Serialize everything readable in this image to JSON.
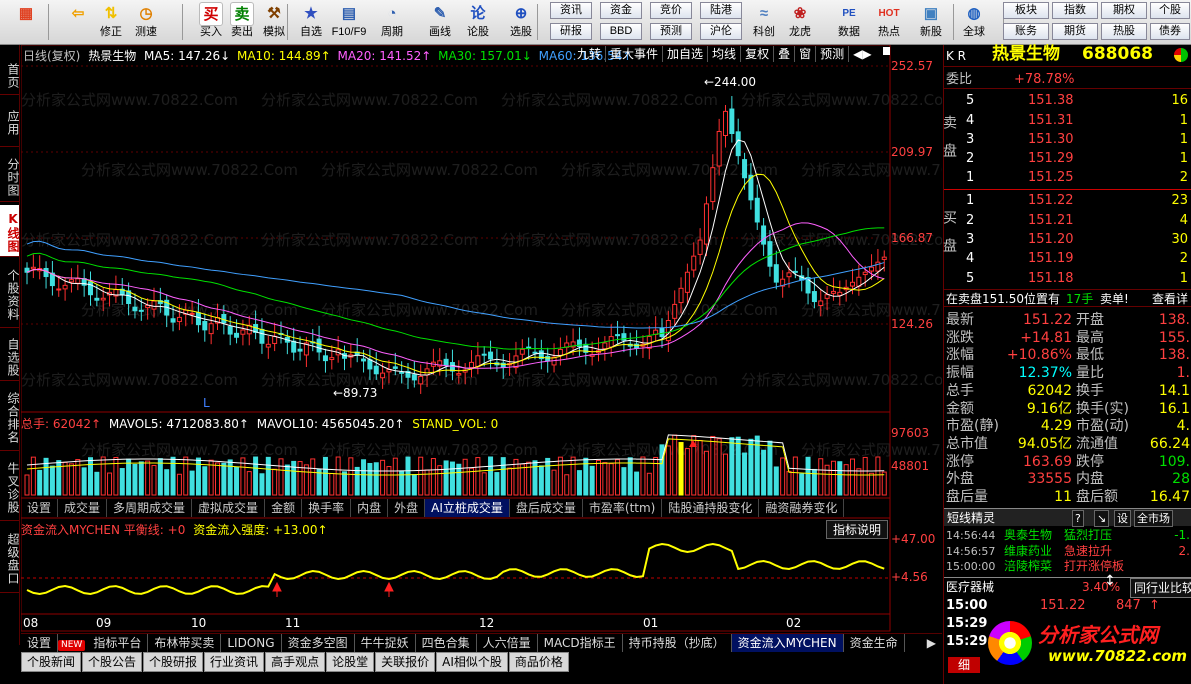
{
  "toolbar": {
    "buttons": [
      {
        "label": "",
        "icon": "grid-icon"
      },
      {
        "label": "",
        "icon": "back-arrow-icon"
      },
      {
        "label": "修正",
        "icon": "up-down-arrows-icon"
      },
      {
        "label": "测速",
        "icon": "clock-icon"
      },
      {
        "label": "买入",
        "icon": "buy-icon",
        "glyph": "买"
      },
      {
        "label": "卖出",
        "icon": "sell-icon",
        "glyph": "卖"
      },
      {
        "label": "模拟",
        "icon": "hammer-icon"
      },
      {
        "label": "自选",
        "icon": "star-icon"
      },
      {
        "label": "F10/F9",
        "icon": "f10-icon"
      },
      {
        "label": "周期",
        "icon": "cycle-icon"
      },
      {
        "label": "画线",
        "icon": "pencil-icon"
      },
      {
        "label": "论股",
        "icon": "discuss-icon",
        "glyph": "论"
      },
      {
        "label": "选股",
        "icon": "magnifier-icon"
      },
      {
        "label": "科创",
        "icon": "tech-chart-icon"
      },
      {
        "label": "龙虎",
        "icon": "dragon-icon"
      },
      {
        "label": "数据",
        "icon": "pe-icon",
        "glyph": "PE"
      },
      {
        "label": "热点",
        "icon": "hot-icon",
        "glyph": "HOT"
      },
      {
        "label": "新股",
        "icon": "new-stock-icon"
      },
      {
        "label": "全球",
        "icon": "globe-icon"
      }
    ],
    "grid1": [
      "资讯",
      "资金",
      "竞价",
      "陆港",
      "研报",
      "BBD",
      "预测",
      "沪伦"
    ],
    "grid2": [
      "板块",
      "指数",
      "期权",
      "个股",
      "账务",
      "期货",
      "热股",
      "债券"
    ]
  },
  "left_tabs": [
    "首页",
    "应用",
    "分时图",
    "K线图",
    "个股资料",
    "自选股",
    "综合排名",
    "牛叉诊股",
    "超级盘口"
  ],
  "header": {
    "period": "日线(复权)",
    "name": "热景生物",
    "ma5": "MA5: 147.26↓",
    "ma10": "MA10: 144.89↑",
    "ma20": "MA20: 141.52↑",
    "ma30": "MA30: 157.01↓",
    "ma60": "MA60: 136.54↑",
    "cmds": [
      "九转",
      "重大事件",
      "加自选",
      "均线",
      "复权",
      "叠",
      "窗",
      "预测"
    ],
    "nav": "◀▶"
  },
  "price_axis": [
    "252.57",
    "209.97",
    "166.87",
    "124.26"
  ],
  "annotations": {
    "high": "←244.00",
    "low": "←89.73",
    "flag": "L"
  },
  "volume": {
    "header_label": "总手: 62042↑",
    "mavol5": "MAVOL5: 4712083.80↑",
    "mavol10": "MAVOL10: 4565045.20↑",
    "stand": "STAND_VOL: 0",
    "axis": [
      "97603",
      "48801"
    ]
  },
  "indicator_tabs": [
    "设置",
    "成交量",
    "多周期成交量",
    "虚拟成交量",
    "金额",
    "换手率",
    "内盘",
    "外盘",
    "AI立桩成交量",
    "盘后成交量",
    "市盈率(ttm)",
    "陆股通持股变化",
    "融资融券变化"
  ],
  "fund_flow": {
    "title": "资金流入MYCHEN 平衡线: +0",
    "strength": "资金流入强度: +13.00↑",
    "help": "指标说明",
    "axis": [
      "+47.00",
      "+4.56"
    ]
  },
  "date_axis": [
    "08",
    "09",
    "10",
    "11",
    "12",
    "01",
    "02"
  ],
  "bottom_tabs": [
    "设置",
    "指标平台",
    "布林带买卖",
    "LIDONG",
    "资金多空图",
    "牛牛捉妖",
    "四色合集",
    "人六倍量",
    "MACD指标王",
    "持币持股（抄底）",
    "资金流入MYCHEN",
    "资金生命"
  ],
  "new_badge": "NEW",
  "bottom_tabs2": [
    "个股新闻",
    "个股公告",
    "个股研报",
    "行业资讯",
    "高手观点",
    "论股堂",
    "关联报价",
    "AI相似个股",
    "商品价格"
  ],
  "right": {
    "market": "K R",
    "name": "热景生物",
    "code": "688068",
    "weibi_label": "委比",
    "weibi": "+78.78%",
    "sell_label": "卖盘",
    "buy_label": "买盘",
    "sell": [
      {
        "lvl": "5",
        "price": "151.38",
        "vol": "16"
      },
      {
        "lvl": "4",
        "price": "151.31",
        "vol": "1"
      },
      {
        "lvl": "3",
        "price": "151.30",
        "vol": "1"
      },
      {
        "lvl": "2",
        "price": "151.29",
        "vol": "1"
      },
      {
        "lvl": "1",
        "price": "151.25",
        "vol": "2"
      }
    ],
    "buy": [
      {
        "lvl": "1",
        "price": "151.22",
        "vol": "23"
      },
      {
        "lvl": "2",
        "price": "151.21",
        "vol": "4"
      },
      {
        "lvl": "3",
        "price": "151.20",
        "vol": "30"
      },
      {
        "lvl": "4",
        "price": "151.19",
        "vol": "2"
      },
      {
        "lvl": "5",
        "price": "151.18",
        "vol": "1"
      }
    ],
    "pos_text": "在卖盘151.50位置有",
    "pos_vol": "17手",
    "pos_sell": "卖单!",
    "pos_view": "查看详",
    "stats": [
      {
        "l1": "最新",
        "v1": "151.22",
        "l2": "开盘",
        "v2": "138."
      },
      {
        "l1": "涨跌",
        "v1": "+14.81",
        "l2": "最高",
        "v2": "155."
      },
      {
        "l1": "涨幅",
        "v1": "+10.86%",
        "l2": "最低",
        "v2": "138."
      },
      {
        "l1": "振幅",
        "v1": "12.37%",
        "l2": "量比",
        "v2": "1."
      },
      {
        "l1": "总手",
        "v1": "62042",
        "l2": "换手",
        "v2": "14.1"
      },
      {
        "l1": "金额",
        "v1": "9.16亿",
        "l2": "换手(实)",
        "v2": "16.1"
      },
      {
        "l1": "市盈(静)",
        "v1": "4.29",
        "l2": "市盈(动)",
        "v2": "4."
      },
      {
        "l1": "总市值",
        "v1": "94.05亿",
        "l2": "流通值",
        "v2": "66.24"
      },
      {
        "l1": "涨停",
        "v1": "163.69",
        "l2": "跌停",
        "v2": "109."
      },
      {
        "l1": "外盘",
        "v1": "33555",
        "l2": "内盘",
        "v2": "28"
      },
      {
        "l1": "盘后量",
        "v1": "11",
        "l2": "盘后额",
        "v2": "16.47"
      }
    ],
    "elves_title": "短线精灵",
    "elves_btns": [
      "?",
      "↘",
      "设",
      "全市场"
    ],
    "elves": [
      {
        "time": "14:56:44",
        "name": "奥泰生物",
        "event": "猛烈打压",
        "val": "-1."
      },
      {
        "time": "14:56:57",
        "name": "维康药业",
        "event": "急速拉升",
        "val": "2."
      },
      {
        "time": "15:00:00",
        "name": "涪陵榨菜",
        "event": "打开涨停板",
        "val": ""
      }
    ],
    "sector_name": "医疗器械",
    "sector_pct": "3.40%",
    "sector_btn": "同行业比较",
    "ticks": [
      {
        "time": "15:00",
        "price": "151.22",
        "vol": "847"
      },
      {
        "time": "15:29",
        "price": "",
        "vol": ""
      },
      {
        "time": "15:29",
        "price": "",
        "vol": ""
      }
    ],
    "logo_text": "分析家公式网",
    "logo_url": "www.70822.com",
    "bottom_tab": "细"
  },
  "watermark": "分析家公式网www.70822.Com"
}
